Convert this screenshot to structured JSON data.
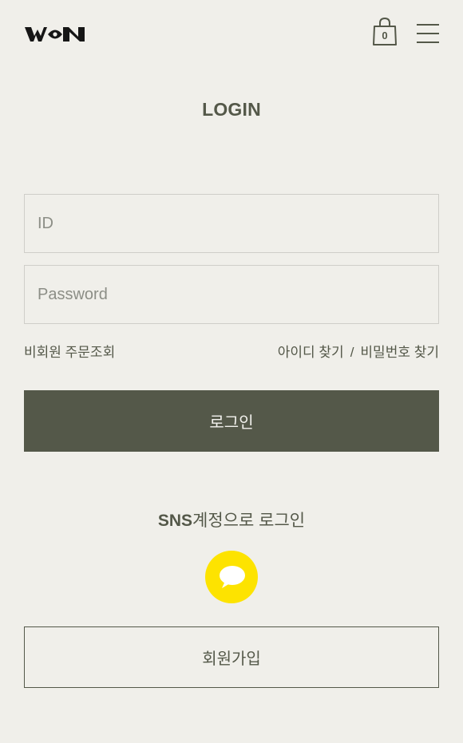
{
  "header": {
    "logo_text": "WON",
    "cart_count": "0",
    "cart_icon": "shopping-bag-icon",
    "menu_icon": "hamburger-menu-icon"
  },
  "page_title": "LOGIN",
  "form": {
    "id_placeholder": "ID",
    "password_placeholder": "Password"
  },
  "links": {
    "guest_order": "비회원 주문조회",
    "find_id": "아이디 찾기",
    "separator": "/",
    "find_password": "비밀번호 찾기"
  },
  "login_button": "로그인",
  "sns": {
    "title_bold": "SNS",
    "title_rest": "계정으로 로그인",
    "kakao_icon": "kakao-talk-icon"
  },
  "join_button": "회원가입",
  "colors": {
    "background": "#f0efea",
    "primary": "#545849",
    "kakao": "#fde300"
  }
}
